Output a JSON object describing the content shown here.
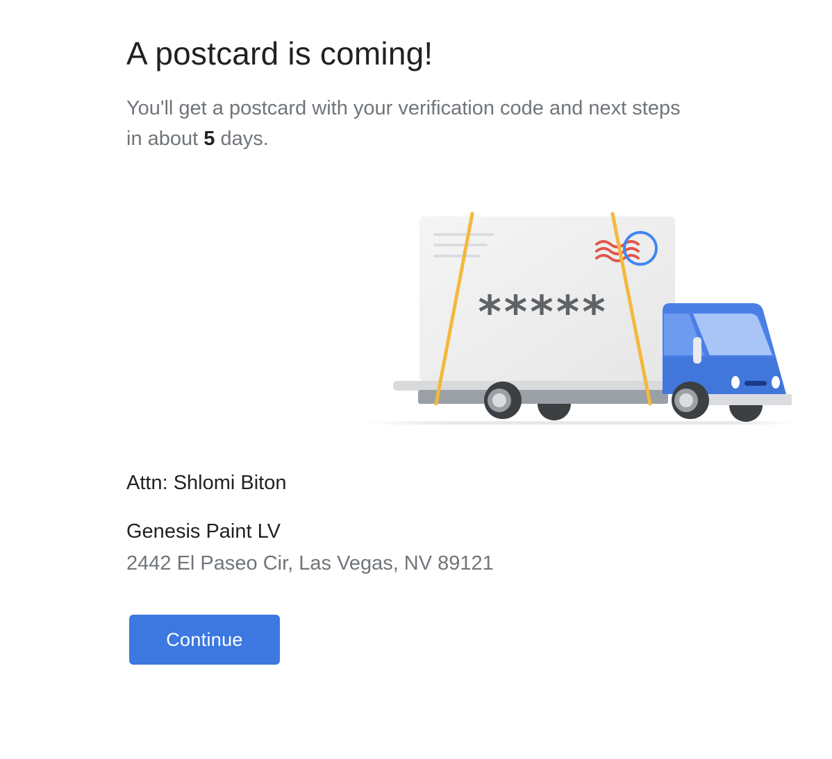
{
  "header": {
    "title": "A postcard is coming!"
  },
  "message": {
    "prefix": "You'll get a postcard with your verification code and next steps in about ",
    "days_count": "5",
    "suffix": " days."
  },
  "illustration": {
    "icon": "postcard-delivery-truck-icon",
    "code_mask": "*****",
    "colors": {
      "truck_blue": "#4a7fe6",
      "strap_yellow": "#f4b83c",
      "stamp_blue": "#4285f4",
      "stamp_red": "#e15549"
    }
  },
  "recipient": {
    "attn": "Attn: Shlomi Biton",
    "business_name": "Genesis Paint LV",
    "address": "2442 El Paseo Cir, Las Vegas, NV 89121"
  },
  "actions": {
    "continue_label": "Continue"
  },
  "colors": {
    "primary_button": "#3c78e0",
    "text_primary": "#202124",
    "text_secondary": "#70757a"
  }
}
